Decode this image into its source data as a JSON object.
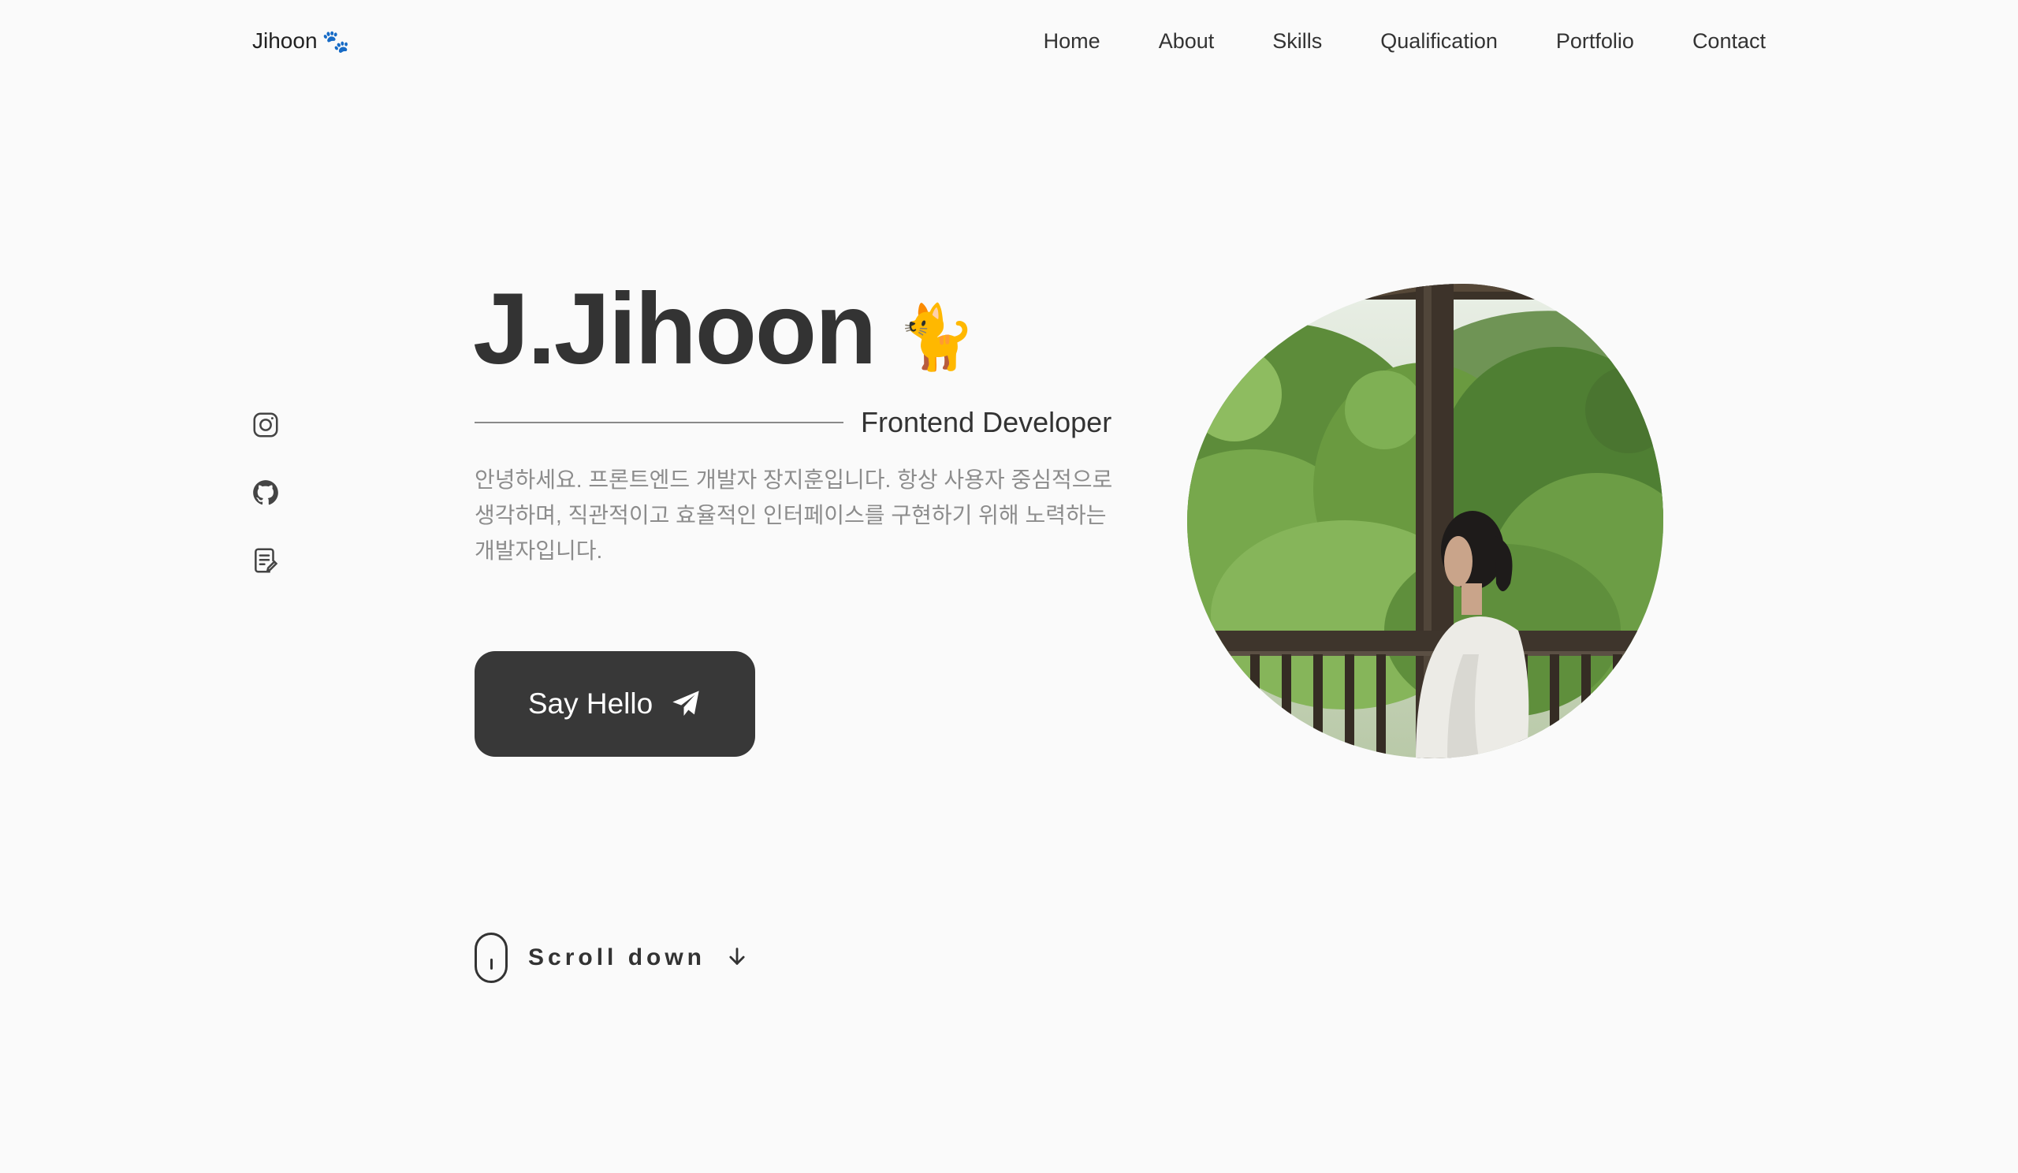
{
  "header": {
    "logo_text": "Jihoon",
    "logo_icon": "🐾",
    "nav": [
      "Home",
      "About",
      "Skills",
      "Qualification",
      "Portfolio",
      "Contact"
    ]
  },
  "social": [
    "instagram-icon",
    "github-icon",
    "blog-icon"
  ],
  "hero": {
    "title": "J.Jihoon",
    "title_emoji": "🐈",
    "subtitle": "Frontend Developer",
    "description": "안녕하세요. 프론트엔드 개발자 장지훈입니다. 항상 사용자 중심적으로 생각하며, 직관적이고 효율적인 인터페이스를 구현하기 위해 노력하는 개발자입니다.",
    "button_label": "Say Hello"
  },
  "scroll": {
    "label": "Scroll down"
  },
  "colors": {
    "background": "#fafafa",
    "text": "#333333",
    "muted": "#8c8c8c",
    "button": "#383838"
  }
}
